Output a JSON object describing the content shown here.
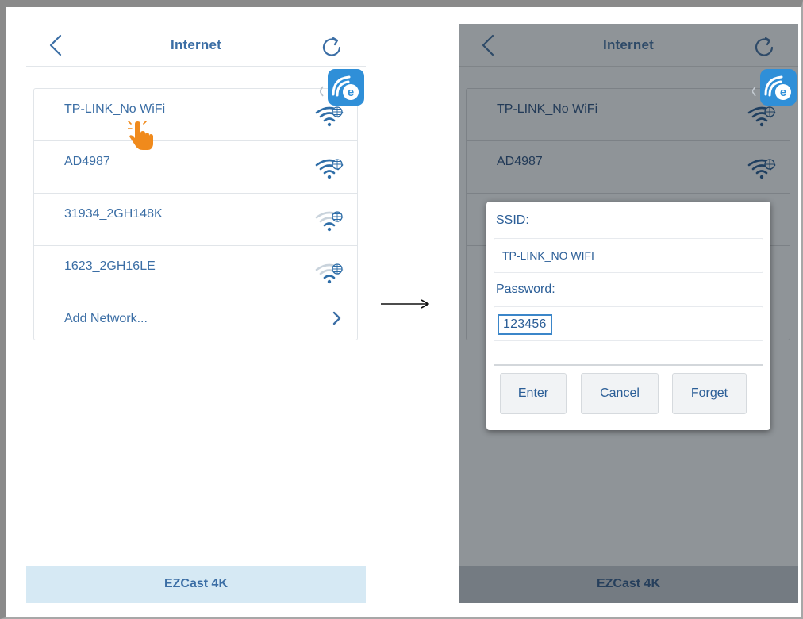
{
  "left_screen": {
    "header": {
      "title": "Internet"
    },
    "networks": [
      {
        "ssid": "TP-LINK_No WiFi"
      },
      {
        "ssid": "AD4987"
      },
      {
        "ssid": "31934_2GH148K"
      },
      {
        "ssid": "1623_2GH16LE"
      }
    ],
    "add_network_label": "Add Network...",
    "footer": {
      "device_name": "EZCast 4K"
    }
  },
  "right_screen": {
    "header": {
      "title": "Internet"
    },
    "networks": [
      {
        "ssid": "TP-LINK_No WiFi"
      },
      {
        "ssid": "AD4987"
      }
    ],
    "footer": {
      "device_name": "EZCast 4K"
    },
    "dialog": {
      "ssid_label": "SSID:",
      "ssid_value": "TP-LINK_NO WIFI",
      "password_label": "Password:",
      "password_value": "123456",
      "buttons": {
        "enter": "Enter",
        "cancel": "Cancel",
        "forget": "Forget"
      }
    }
  },
  "icons": {
    "back": "chevron-left-icon",
    "refresh": "refresh-icon",
    "app_badge": "ezcast-app-icon",
    "wifi": "wifi-globe-icon",
    "pointer": "hand-pointer-icon",
    "flow_arrow": "arrow-right-icon"
  },
  "colors": {
    "accent_text": "#3b6ea5",
    "footer_background": "#d6e9f4",
    "overlay_background": "#8f9498",
    "hand_pointer": "#f08a1c",
    "app_badge": "#2f8fd8"
  }
}
